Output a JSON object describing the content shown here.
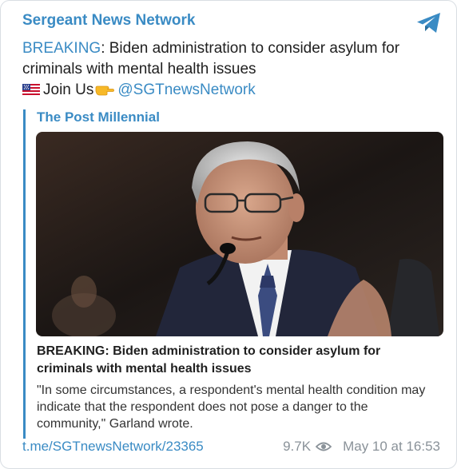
{
  "channel": {
    "name": "Sergeant News Network"
  },
  "post": {
    "breaking_keyword": "BREAKING",
    "headline_rest": ": Biden administration to consider asylum for criminals with mental health issues",
    "join_text": "Join Us",
    "mention": "@SGTnewsNetwork"
  },
  "preview": {
    "site_name": "The Post Millennial",
    "title": "BREAKING: Biden administration to consider asylum for criminals with mental health issues",
    "description": "\"In some circumstances, a respondent's mental health condition may indicate that the respondent does not pose a danger to the community,\" Garland wrote."
  },
  "footer": {
    "link": "t.me/SGTnewsNetwork/23365",
    "views": "9.7K",
    "date": "May 10 at 16:53"
  },
  "icons": {
    "share": "telegram-plane-icon",
    "flag": "us-flag-icon",
    "hand": "pointing-hand-icon",
    "views": "eye-icon"
  },
  "colors": {
    "accent": "#3a8bc4",
    "text": "#1f1f1f",
    "meta": "#8a9299"
  }
}
